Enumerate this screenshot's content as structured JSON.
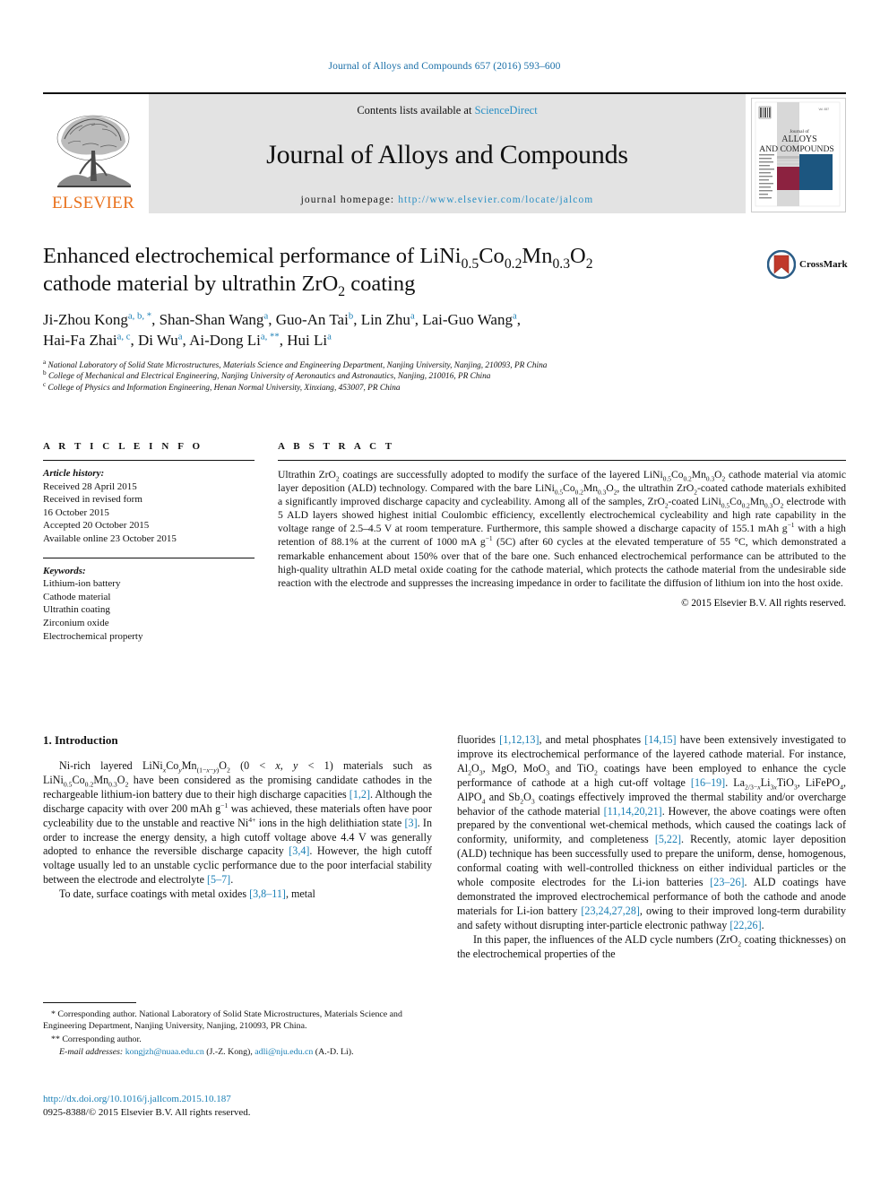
{
  "running_head": "Journal of Alloys and Compounds 657 (2016) 593–600",
  "masthead": {
    "publisher_name": "ELSEVIER",
    "contents_prefix": "Contents lists available at ",
    "contents_link": "ScienceDirect",
    "journal_name": "Journal of Alloys and Compounds",
    "homepage_prefix": "journal homepage: ",
    "homepage_url": "http://www.elsevier.com/locate/jalcom",
    "cover": {
      "line1": "Journal of",
      "line2": "ALLOYS",
      "line3": "AND COMPOUNDS"
    }
  },
  "article": {
    "title_line1_pre": "Enhanced electrochemical performance of LiNi",
    "title_sub1": "0.5",
    "title_mid1": "Co",
    "title_sub2": "0.2",
    "title_mid2": "Mn",
    "title_sub3": "0.3",
    "title_mid3": "O",
    "title_sub4": "2",
    "title_line2_pre": "cathode material by ultrathin ZrO",
    "title_sub5": "2",
    "title_line2_post": " coating",
    "crossmark_label": "CrossMark",
    "authors": [
      {
        "name": "Ji-Zhou Kong",
        "marks": "a, b, *"
      },
      {
        "name": "Shan-Shan Wang",
        "marks": "a"
      },
      {
        "name": "Guo-An Tai",
        "marks": "b"
      },
      {
        "name": "Lin Zhu",
        "marks": "a"
      },
      {
        "name": "Lai-Guo Wang",
        "marks": "a"
      },
      {
        "name": "Hai-Fa Zhai",
        "marks": "a, c"
      },
      {
        "name": "Di Wu",
        "marks": "a"
      },
      {
        "name": "Ai-Dong Li",
        "marks": "a, **"
      },
      {
        "name": "Hui Li",
        "marks": "a"
      }
    ],
    "affiliations": [
      {
        "mark": "a",
        "text": "National Laboratory of Solid State Microstructures, Materials Science and Engineering Department, Nanjing University, Nanjing, 210093, PR China"
      },
      {
        "mark": "b",
        "text": "College of Mechanical and Electrical Engineering, Nanjing University of Aeronautics and Astronautics, Nanjing, 210016, PR China"
      },
      {
        "mark": "c",
        "text": "College of Physics and Information Engineering, Henan Normal University, Xinxiang, 453007, PR China"
      }
    ]
  },
  "article_info": {
    "heading": "A R T I C L E   I N F O",
    "history_label": "Article history:",
    "history": [
      "Received 28 April 2015",
      "Received in revised form",
      "16 October 2015",
      "Accepted 20 October 2015",
      "Available online 23 October 2015"
    ],
    "keywords_label": "Keywords:",
    "keywords": [
      "Lithium-ion battery",
      "Cathode material",
      "Ultrathin coating",
      "Zirconium oxide",
      "Electrochemical property"
    ]
  },
  "abstract": {
    "heading": "A B S T R A C T",
    "copyright": "© 2015 Elsevier B.V. All rights reserved."
  },
  "introduction": {
    "heading": "1.  Introduction"
  },
  "footnotes": {
    "corresponding1": "* Corresponding author. National Laboratory of Solid State Microstructures, Materials Science and Engineering Department, Nanjing University, Nanjing, 210093, PR China.",
    "corresponding2": "** Corresponding author.",
    "email_label": "E-mail addresses:",
    "email1": "kongjzh@nuaa.edu.cn",
    "email1_attr": "(J.-Z. Kong),",
    "email2": "adli@nju.edu.cn",
    "email2_attr": "(A.-D. Li)."
  },
  "doi": {
    "url": "http://dx.doi.org/10.1016/j.jallcom.2015.10.187",
    "issn_line": "0925-8388/© 2015 Elsevier B.V. All rights reserved."
  },
  "colors": {
    "link_blue": "#1a7fb5",
    "sciencedirect_blue": "#2a8fc4",
    "elsevier_orange": "#E9711C",
    "masthead_gray": "#e3e3e3",
    "cover_red": "#8c2240",
    "cover_navy": "#1c5680"
  }
}
